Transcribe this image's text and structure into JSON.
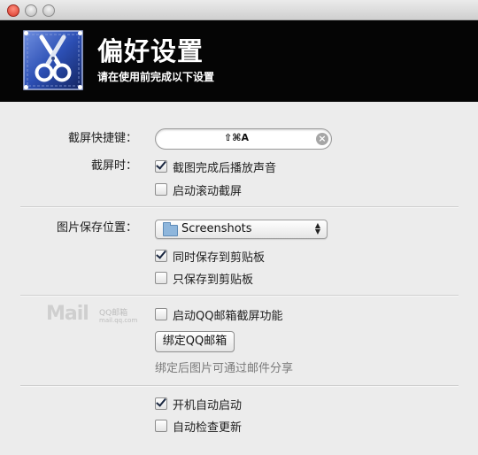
{
  "header": {
    "title": "偏好设置",
    "subtitle": "请在使用前完成以下设置"
  },
  "capture": {
    "hotkey_label": "截屏快捷键：",
    "hotkey_value": "⇧⌘A",
    "when_label": "截屏时：",
    "opt_sound": {
      "label": "截图完成后播放声音",
      "checked": true
    },
    "opt_scroll": {
      "label": "启动滚动截屏",
      "checked": false
    }
  },
  "save": {
    "location_label": "图片保存位置：",
    "folder": "Screenshots",
    "opt_also_clipboard": {
      "label": "同时保存到剪贴板",
      "checked": true
    },
    "opt_only_clipboard": {
      "label": "只保存到剪贴板",
      "checked": false
    }
  },
  "qqmail": {
    "logo_text": "Mail",
    "logo_cn": "QQ邮箱",
    "logo_domain": "mail.qq.com",
    "opt_enable": {
      "label": "启动QQ邮箱截屏功能",
      "checked": false
    },
    "bind_button": "绑定QQ邮箱",
    "hint": "绑定后图片可通过邮件分享"
  },
  "general": {
    "opt_autostart": {
      "label": "开机自动启动",
      "checked": true
    },
    "opt_autoupdate": {
      "label": "自动检查更新",
      "checked": false
    }
  }
}
